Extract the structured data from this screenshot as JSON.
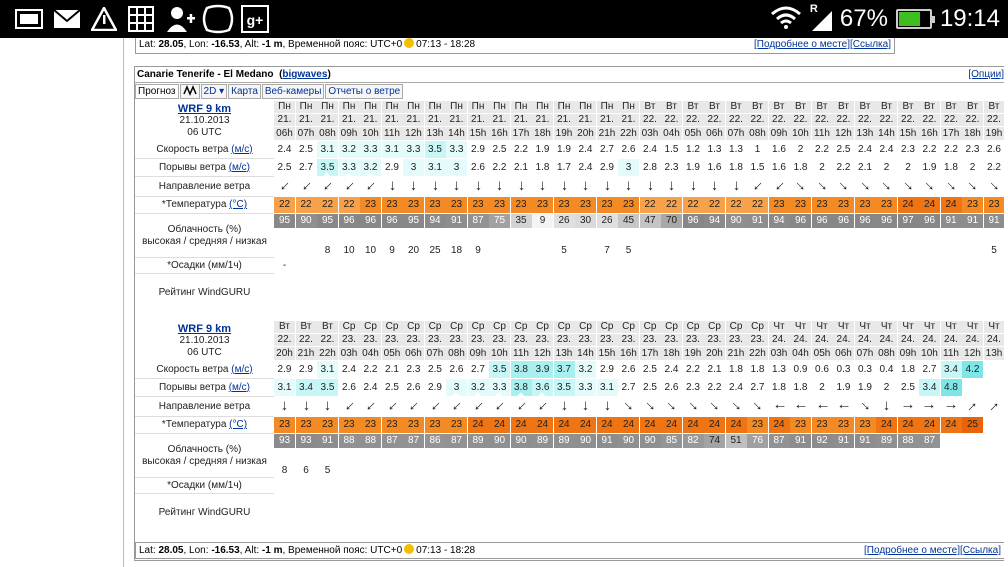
{
  "status": {
    "battery": "67%",
    "battery_level": 67,
    "time": "19:14",
    "signal": "R"
  },
  "location": {
    "lat_label": "Lat: ",
    "lat": "28.05",
    "lon_label": ", Lon: ",
    "lon": "-16.53",
    "alt_label": ", Alt: ",
    "alt": "-1 m",
    "tz": ", Временной пояс: UTC+0",
    "sun": "07:13 - 18:28",
    "more": "[Подробнее о месте]",
    "link": "[Ссылка]"
  },
  "panel": {
    "title": "Canarie Tenerife - El Medano",
    "title_link": "bigwaves",
    "options": "[Опции]",
    "tabs": [
      "Прогноз",
      "2D",
      "Карта",
      "Веб-камеры",
      "Отчеты о ветре"
    ]
  },
  "labels": {
    "wind": "Скорость ветра",
    "gust": "Порывы ветра",
    "unit_wind": "(м/с)",
    "dir": "Направление ветра",
    "temp": "*Температура",
    "unit_temp": "(°C)",
    "cloud1": "Облачность (%)",
    "cloud2": "высокая / средняя / низкая",
    "precip": "*Осадки (мм/1ч)",
    "rating": "Рейтинг WindGURU"
  },
  "forecasts": [
    {
      "model": "WRF 9 km",
      "date": "21.10.2013",
      "utc": "06 UTC",
      "days": [
        "Пн",
        "Пн",
        "Пн",
        "Пн",
        "Пн",
        "Пн",
        "Пн",
        "Пн",
        "Пн",
        "Пн",
        "Пн",
        "Пн",
        "Пн",
        "Пн",
        "Пн",
        "Пн",
        "Пн",
        "Вт",
        "Вт",
        "Вт",
        "Вт",
        "Вт",
        "Вт",
        "Вт",
        "Вт",
        "Вт",
        "Вт",
        "Вт",
        "Вт",
        "Вт",
        "Вт",
        "Вт",
        "Вт",
        "Вт"
      ],
      "dates": [
        "21.",
        "21.",
        "21.",
        "21.",
        "21.",
        "21.",
        "21.",
        "21.",
        "21.",
        "21.",
        "21.",
        "21.",
        "21.",
        "21.",
        "21.",
        "21.",
        "21.",
        "22.",
        "22.",
        "22.",
        "22.",
        "22.",
        "22.",
        "22.",
        "22.",
        "22.",
        "22.",
        "22.",
        "22.",
        "22.",
        "22.",
        "22.",
        "22.",
        "22."
      ],
      "hours": [
        "06h",
        "07h",
        "08h",
        "09h",
        "10h",
        "11h",
        "12h",
        "13h",
        "14h",
        "15h",
        "16h",
        "17h",
        "18h",
        "19h",
        "20h",
        "21h",
        "22h",
        "03h",
        "04h",
        "05h",
        "06h",
        "07h",
        "08h",
        "09h",
        "10h",
        "11h",
        "12h",
        "13h",
        "14h",
        "15h",
        "16h",
        "17h",
        "18h",
        "19h"
      ],
      "wind": [
        "2.4",
        "2.5",
        "3.1",
        "3.2",
        "3.3",
        "3.1",
        "3.3",
        "3.5",
        "3.3",
        "2.9",
        "2.5",
        "2.2",
        "1.9",
        "1.9",
        "2.4",
        "2.7",
        "2.6",
        "2.4",
        "1.5",
        "1.2",
        "1.3",
        "1.3",
        "1",
        "1.6",
        "2",
        "2.2",
        "2.5",
        "2.4",
        "2.4",
        "2.3",
        "2.2",
        "2.2",
        "2.3",
        "2.6"
      ],
      "gust": [
        "2.5",
        "2.7",
        "3.5",
        "3.3",
        "3.2",
        "2.9",
        "3",
        "3.1",
        "3",
        "2.6",
        "2.2",
        "2.1",
        "1.8",
        "1.7",
        "2.4",
        "2.9",
        "3",
        "2.8",
        "2.3",
        "1.9",
        "1.6",
        "1.8",
        "1.5",
        "1.6",
        "1.8",
        "2",
        "2.2",
        "2.1",
        "2",
        "2",
        "1.9",
        "1.8",
        "2",
        "2.2"
      ],
      "dir": [
        225,
        225,
        225,
        225,
        225,
        180,
        180,
        180,
        180,
        180,
        180,
        180,
        180,
        180,
        180,
        180,
        180,
        180,
        180,
        180,
        180,
        180,
        225,
        225,
        135,
        135,
        135,
        135,
        135,
        135,
        135,
        135,
        135,
        135
      ],
      "temp": [
        "22",
        "22",
        "22",
        "22",
        "23",
        "23",
        "23",
        "23",
        "23",
        "23",
        "23",
        "23",
        "23",
        "23",
        "23",
        "23",
        "23",
        "22",
        "22",
        "22",
        "22",
        "22",
        "22",
        "23",
        "23",
        "23",
        "23",
        "23",
        "23",
        "24",
        "24",
        "24",
        "23",
        "23"
      ],
      "cloud": [
        "95",
        "90",
        "95",
        "96",
        "96",
        "96",
        "95",
        "94",
        "91",
        "87",
        "75",
        "35",
        "9",
        "26",
        "30",
        "26",
        "45",
        "47",
        "70",
        "96",
        "94",
        "90",
        "91",
        "94",
        "96",
        "96",
        "96",
        "96",
        "96",
        "97",
        "96",
        "91",
        "91",
        "91"
      ],
      "low": [
        "",
        "",
        "8",
        "10",
        "10",
        "9",
        "20",
        "25",
        "18",
        "9",
        "",
        "",
        "",
        "5",
        "",
        "7",
        "5",
        "",
        "",
        "",
        "",
        "",
        "",
        "",
        "",
        "",
        "",
        "",
        "",
        "",
        "",
        "",
        "",
        "5"
      ],
      "precip": [
        "-",
        "",
        "",
        "",
        "",
        "",
        "",
        "",
        "",
        "",
        "",
        "",
        "",
        "",
        "",
        "",
        "",
        "",
        "",
        "",
        "",
        "",
        "",
        "",
        "",
        "",
        "",
        "",
        "",
        "",
        "",
        "",
        "",
        ""
      ]
    },
    {
      "model": "WRF 9 km",
      "date": "21.10.2013",
      "utc": "06 UTC",
      "days": [
        "Вт",
        "Вт",
        "Вт",
        "Ср",
        "Ср",
        "Ср",
        "Ср",
        "Ср",
        "Ср",
        "Ср",
        "Ср",
        "Ср",
        "Ср",
        "Ср",
        "Ср",
        "Ср",
        "Ср",
        "Ср",
        "Ср",
        "Ср",
        "Ср",
        "Ср",
        "Ср",
        "Чт",
        "Чт",
        "Чт",
        "Чт",
        "Чт",
        "Чт",
        "Чт",
        "Чт",
        "Чт",
        "Чт",
        "Чт"
      ],
      "dates": [
        "22.",
        "22.",
        "22.",
        "23.",
        "23.",
        "23.",
        "23.",
        "23.",
        "23.",
        "23.",
        "23.",
        "23.",
        "23.",
        "23.",
        "23.",
        "23.",
        "23.",
        "23.",
        "23.",
        "23.",
        "23.",
        "23.",
        "23.",
        "24.",
        "24.",
        "24.",
        "24.",
        "24.",
        "24.",
        "24.",
        "24.",
        "24.",
        "24.",
        "24."
      ],
      "hours": [
        "20h",
        "21h",
        "22h",
        "03h",
        "04h",
        "05h",
        "06h",
        "07h",
        "08h",
        "09h",
        "10h",
        "11h",
        "12h",
        "13h",
        "14h",
        "15h",
        "16h",
        "17h",
        "18h",
        "19h",
        "20h",
        "21h",
        "22h",
        "03h",
        "04h",
        "05h",
        "06h",
        "07h",
        "08h",
        "09h",
        "10h",
        "11h",
        "12h",
        "13h"
      ],
      "wind": [
        "2.9",
        "2.9",
        "3.1",
        "2.4",
        "2.2",
        "2.1",
        "2.3",
        "2.5",
        "2.6",
        "2.7",
        "3.5",
        "3.8",
        "3.9",
        "3.7",
        "3.2",
        "2.9",
        "2.6",
        "2.5",
        "2.4",
        "2.2",
        "2.1",
        "1.8",
        "1.8",
        "1.3",
        "0.9",
        "0.6",
        "0.3",
        "0.3",
        "0.4",
        "1.8",
        "2.7",
        "3.4",
        "4.2",
        ""
      ],
      "gust": [
        "3.1",
        "3.4",
        "3.5",
        "2.6",
        "2.4",
        "2.5",
        "2.6",
        "2.9",
        "3",
        "3.2",
        "3.3",
        "3.8",
        "3.6",
        "3.5",
        "3.3",
        "3.1",
        "2.7",
        "2.5",
        "2.6",
        "2.3",
        "2.2",
        "2.4",
        "2.7",
        "1.8",
        "1.8",
        "2",
        "1.9",
        "1.9",
        "2",
        "2.5",
        "3.4",
        "4.8",
        "",
        ""
      ],
      "dir": [
        180,
        180,
        180,
        225,
        225,
        225,
        225,
        225,
        225,
        225,
        225,
        225,
        225,
        180,
        180,
        180,
        135,
        135,
        135,
        135,
        135,
        135,
        135,
        270,
        270,
        270,
        270,
        135,
        180,
        90,
        90,
        90,
        45,
        45
      ],
      "temp": [
        "23",
        "23",
        "23",
        "23",
        "23",
        "23",
        "23",
        "23",
        "23",
        "24",
        "24",
        "24",
        "24",
        "24",
        "24",
        "24",
        "24",
        "24",
        "24",
        "24",
        "24",
        "24",
        "23",
        "24",
        "23",
        "23",
        "23",
        "23",
        "24",
        "24",
        "24",
        "24",
        "25",
        ""
      ],
      "cloud": [
        "93",
        "93",
        "91",
        "88",
        "88",
        "87",
        "87",
        "86",
        "87",
        "89",
        "90",
        "90",
        "89",
        "89",
        "90",
        "91",
        "90",
        "90",
        "85",
        "82",
        "74",
        "51",
        "76",
        "87",
        "91",
        "92",
        "91",
        "91",
        "89",
        "88",
        "87",
        "",
        "",
        ""
      ],
      "low": [
        "8",
        "6",
        "5",
        "",
        "",
        "",
        "",
        "",
        "",
        "",
        "",
        "",
        "",
        "",
        "",
        "",
        "",
        "",
        "",
        "",
        "",
        "",
        "",
        "",
        "",
        "",
        "",
        "",
        "",
        "",
        "",
        "",
        "",
        ""
      ],
      "precip": [
        "",
        "",
        "",
        "",
        "",
        "",
        "",
        "",
        "",
        "",
        "",
        "",
        "",
        "",
        "",
        "",
        "",
        "",
        "",
        "",
        "",
        "",
        "",
        "",
        "",
        "",
        "",
        "",
        "",
        "",
        "",
        "",
        "",
        ""
      ]
    }
  ],
  "bottom": {
    "lat": "28.05",
    "lon": "-16.53",
    "alt": "-1 m",
    "sun": "07:13 - 18:28",
    "more": "[Подробнее о месте]",
    "link": "[Ссылка]"
  }
}
